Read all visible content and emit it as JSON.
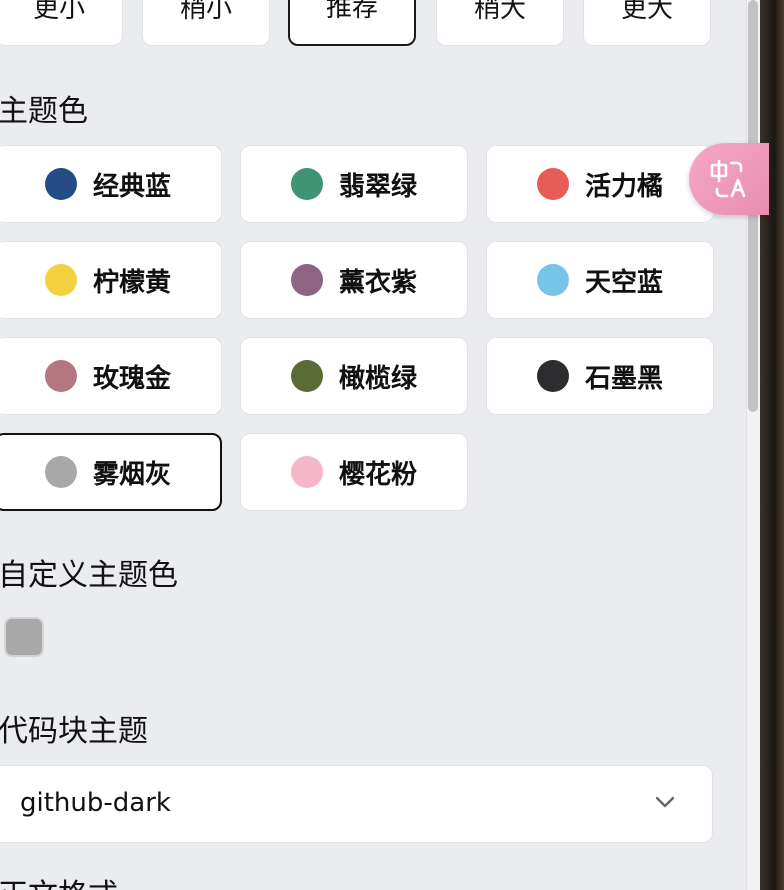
{
  "font_size": {
    "options": [
      "更小",
      "稍小",
      "推荐",
      "稍大",
      "更大"
    ],
    "selected": "推荐"
  },
  "theme": {
    "heading": "主题色",
    "colors": [
      {
        "label": "经典蓝",
        "color": "#254d85"
      },
      {
        "label": "翡翠绿",
        "color": "#3f9474"
      },
      {
        "label": "活力橘",
        "color": "#e85c58"
      },
      {
        "label": "柠檬黄",
        "color": "#f3d13e"
      },
      {
        "label": "薰衣紫",
        "color": "#8d6482"
      },
      {
        "label": "天空蓝",
        "color": "#76c4e7"
      },
      {
        "label": "玫瑰金",
        "color": "#b47681"
      },
      {
        "label": "橄榄绿",
        "color": "#5a6b35"
      },
      {
        "label": "石墨黑",
        "color": "#2d2d2f"
      },
      {
        "label": "雾烟灰",
        "color": "#a8a8a8"
      },
      {
        "label": "樱花粉",
        "color": "#f4b7c8"
      }
    ],
    "selected": "雾烟灰"
  },
  "custom_theme": {
    "heading": "自定义主题色",
    "value_color": "#a8a8a8"
  },
  "code_theme": {
    "heading": "代码块主题",
    "value": "github-dark"
  },
  "next_section": {
    "heading": "正文格式"
  },
  "translate_button": {
    "icon": "translate-icon"
  }
}
